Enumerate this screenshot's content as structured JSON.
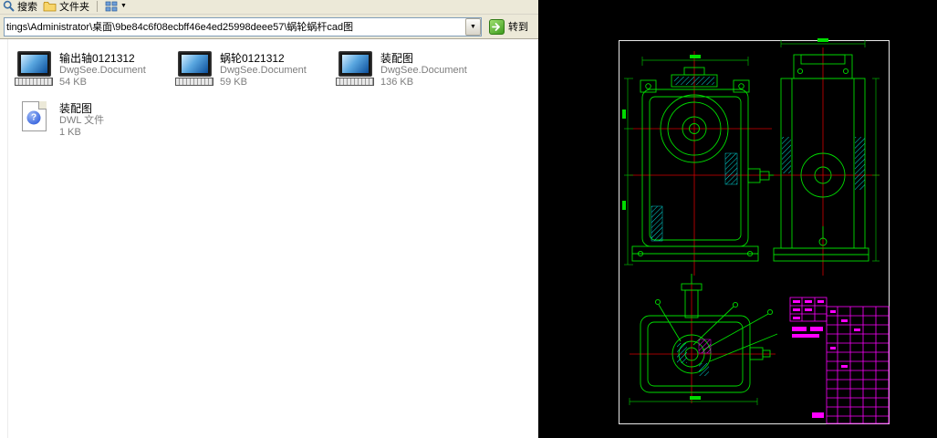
{
  "explorer": {
    "toolbar": {
      "search_label": "搜索",
      "folders_label": "文件夹"
    },
    "address": {
      "path": "tings\\Administrator\\桌面\\9be84c6f08ecbff46e4ed25998deee57\\蜗轮蜗杆cad图",
      "go_label": "转到"
    },
    "files": [
      {
        "name": "输出轴0121312",
        "type": "DwgSee.Document",
        "size": "54 KB",
        "icon": "dwgsee"
      },
      {
        "name": "蜗轮0121312",
        "type": "DwgSee.Document",
        "size": "59 KB",
        "icon": "dwgsee"
      },
      {
        "name": "装配图",
        "type": "DwgSee.Document",
        "size": "136 KB",
        "icon": "dwgsee"
      },
      {
        "name": "装配图",
        "type": "DWL 文件",
        "size": "1 KB",
        "icon": "dwl"
      }
    ]
  },
  "icons": {
    "caret_down": "▼",
    "question_glyph": "?"
  },
  "cad": {
    "colors": {
      "background": "#000000",
      "frame": "#e8e8e8",
      "line": "#00dc00",
      "centerline": "#d40000",
      "hatch": "#00d8d8",
      "table": "#ff00ff"
    }
  }
}
